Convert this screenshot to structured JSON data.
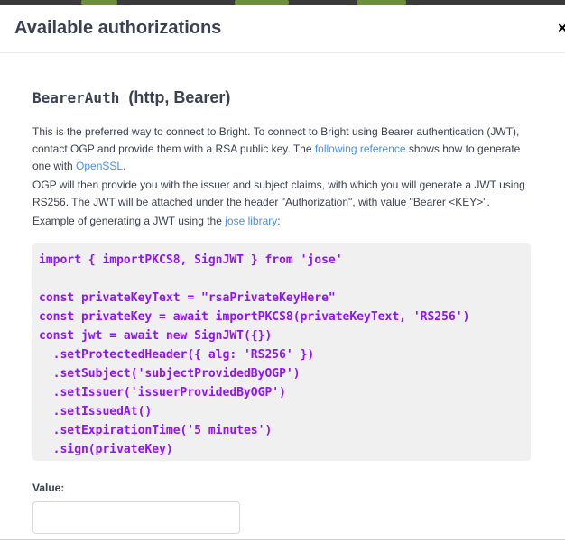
{
  "modal": {
    "title": "Available authorizations",
    "close_label": "×"
  },
  "scheme": {
    "name": "BearerAuth",
    "type": "(http, Bearer)"
  },
  "description": {
    "p1_text1": "This is the preferred way to connect to Bright. To connect to Bright using Bearer authentication (JWT), contact OGP and provide them with a RSA public key. The ",
    "p1_link1": "following reference",
    "p1_text2": " shows how to generate one with ",
    "p1_link2": "OpenSSL",
    "p1_text3": ".",
    "p2": "OGP will then provide you with the issuer and subject claims, with which you will generate a JWT using RS256. The JWT will be attached under the header \"Authorization\", with value \"Bearer <KEY>\".",
    "p3_text1": "Example of generating a JWT using the ",
    "p3_link": "jose library",
    "p3_text2": ":"
  },
  "code": "import { importPKCS8, SignJWT } from 'jose'\n\nconst privateKeyText = \"rsaPrivateKeyHere\"\nconst privateKey = await importPKCS8(privateKeyText, 'RS256')\nconst jwt = await new SignJWT({})\n  .setProtectedHeader({ alg: 'RS256' })\n  .setSubject('subjectProvidedByOGP')\n  .setIssuer('issuerProvidedByOGP')\n  .setIssuedAt()\n  .setExpirationTime('5 minutes')\n  .sign(privateKey)",
  "value_field": {
    "label": "Value:",
    "value": "",
    "placeholder": ""
  },
  "colors": {
    "link": "#4990e2",
    "code": "#9012fe",
    "text": "#3b4151"
  }
}
